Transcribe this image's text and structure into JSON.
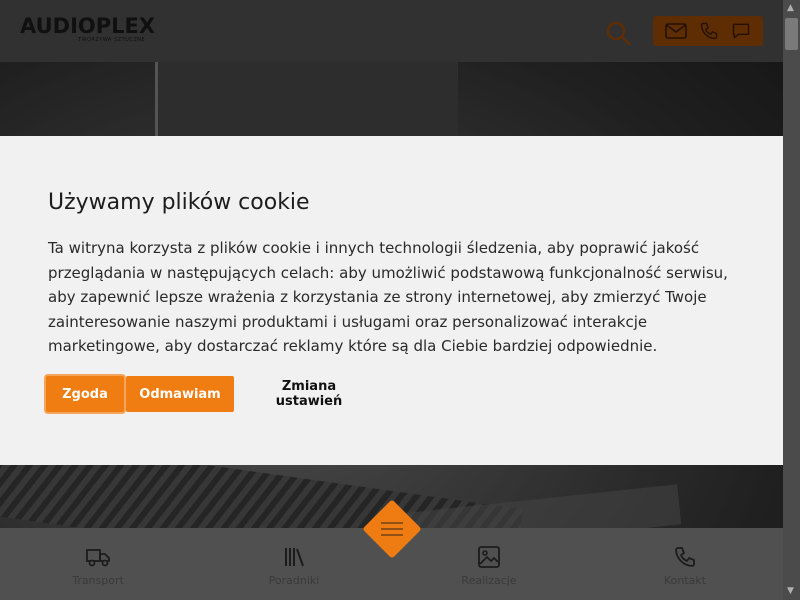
{
  "brand": {
    "name": "AUDIOPLEX",
    "tagline": "TWORZYWA SZTUCZNE"
  },
  "header": {
    "icons": [
      "search-icon",
      "mail-icon",
      "phone-icon",
      "chat-icon"
    ],
    "accent": "#ef7d12"
  },
  "cookie": {
    "title": "Używamy plików cookie",
    "text": "Ta witryna korzysta z plików cookie i innych technologii śledzenia, aby poprawić jakość przeglądania w następujących celach: aby umożliwić podstawową funkcjonalność serwisu, aby zapewnić lepsze wrażenia z korzystania ze strony internetowej, aby zmierzyć Twoje zainteresowanie naszymi produktami i usługami oraz personalizować interakcje marketingowe, aby dostarczać reklamy które są dla Ciebie bardziej odpowiednie.",
    "accept_label": "Zgoda",
    "deny_label": "Odmawiam",
    "settings_label": "Zmiana ustawień"
  },
  "bottom_nav": {
    "items": [
      {
        "label": "Transport",
        "icon": "truck-icon"
      },
      {
        "label": "Poradniki",
        "icon": "books-icon"
      },
      {
        "label": "Realizacje",
        "icon": "image-icon"
      },
      {
        "label": "Kontakt",
        "icon": "phone-icon"
      }
    ],
    "center_icon": "menu-icon"
  }
}
